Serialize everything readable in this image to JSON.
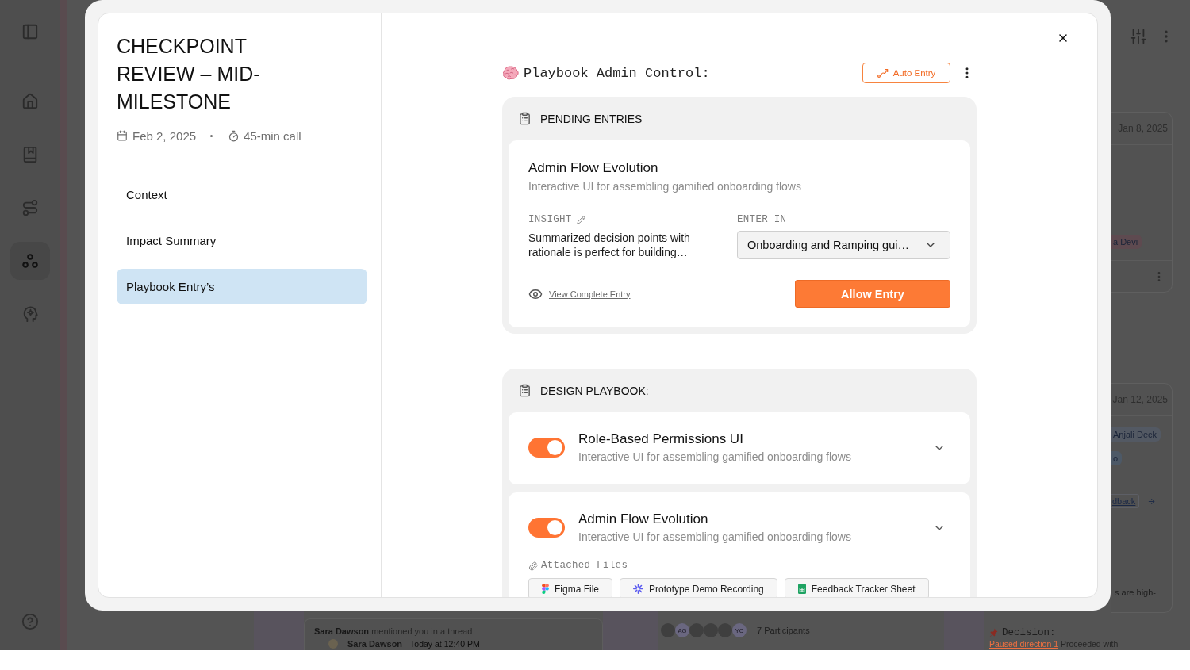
{
  "app": {
    "sidebar": {
      "items": [
        {
          "selected": false
        },
        {
          "selected": false
        },
        {
          "selected": false
        },
        {
          "selected": true
        },
        {
          "selected": false
        }
      ]
    },
    "cards": [
      {
        "date": "Jan 8, 2025",
        "tags": [
          {
            "label": "a Devi",
            "color": "#5e4a50"
          }
        ]
      },
      {
        "date": "Jan 12, 2025",
        "tags": [
          {
            "label": "Anjali Deck",
            "color": "#535963"
          },
          {
            "label": "o",
            "color": "#4d5967"
          }
        ],
        "link": "dback",
        "note": "s are high-"
      }
    ],
    "mention": {
      "text": "**Sara Dawson** mentioned you in a thread",
      "author": "Sara Dawson",
      "time": "Today at 12:40 PM"
    },
    "participants": {
      "avatars": [
        {
          "kind": "photo"
        },
        {
          "kind": "initials",
          "initials": "AG"
        },
        {
          "kind": "photo"
        },
        {
          "kind": "photo"
        },
        {
          "kind": "photo"
        },
        {
          "kind": "initials",
          "initials": "YC"
        }
      ],
      "label": "7 Participants"
    },
    "decision": {
      "label": "Decision:",
      "link": "Paused direction 1",
      "text": "Proceeded with"
    }
  },
  "modal": {
    "title": "CHECKPOINT REVIEW – MID-MILESTONE",
    "date": "Feb 2, 2025",
    "duration": "45-min call",
    "nav": [
      {
        "label": "Context",
        "selected": false
      },
      {
        "label": "Impact Summary",
        "selected": false
      },
      {
        "label": "Playbook Entry’s",
        "selected": true
      }
    ],
    "header": {
      "title": "Playbook Admin Control:",
      "action": "Auto Entry"
    },
    "pending": {
      "heading": "PENDING ENTRIES",
      "entries": [
        {
          "title": "Admin Flow Evolution",
          "description": "Interactive UI for assembling gamified onboarding flows",
          "insight_label": "INSIGHT",
          "insight": "Summarized decision points with rationale is perfect for building…",
          "target_label": "ENTER IN",
          "target": "Onboarding and Ramping gui…",
          "link": "View Complete Entry",
          "button": "Allow Entry"
        }
      ]
    },
    "playbook": {
      "heading": "DESIGN PLAYBOOK:",
      "items": [
        {
          "title": "Role-Based Permissions UI",
          "description": "Interactive UI for assembling gamified onboarding flows",
          "on": true
        },
        {
          "title": "Admin Flow Evolution",
          "description": "Interactive UI for assembling gamified onboarding flows",
          "on": true,
          "attachments_label": "Attached Files",
          "attachments": [
            {
              "kind": "figma",
              "name": "Figma File"
            },
            {
              "kind": "recording",
              "name": "Prototype Demo Recording"
            },
            {
              "kind": "sheet",
              "name": "Feedback Tracker Sheet"
            }
          ]
        }
      ]
    }
  }
}
